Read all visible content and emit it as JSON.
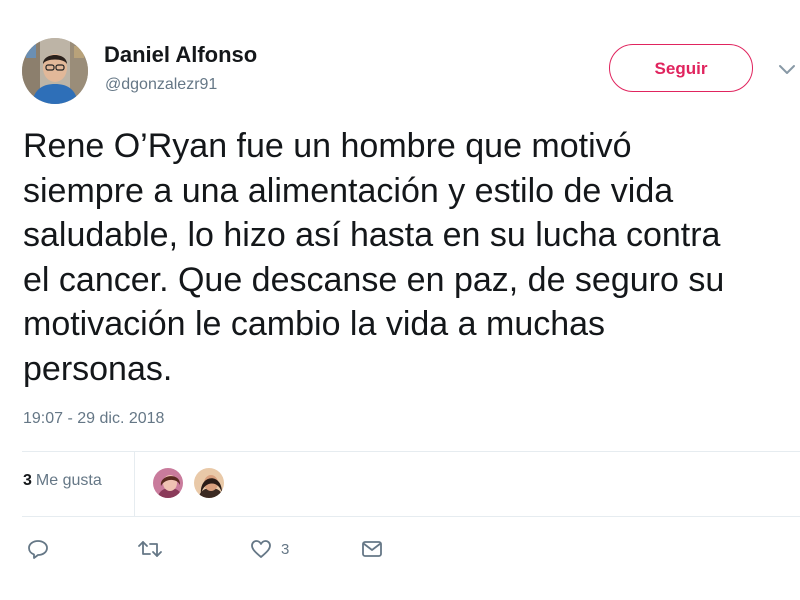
{
  "tweet": {
    "author": {
      "name": "Daniel Alfonso",
      "handle": "@dgonzalezr91"
    },
    "follow_label": "Seguir",
    "text_lines": [
      "Rene O’Ryan fue un hombre que motivó",
      "siempre a una alimentación y estilo de vida",
      "saludable, lo hizo así hasta en su lucha contra",
      "el cancer. Que descanse en paz, de seguro su",
      "motivación le cambio la vida a muchas",
      "personas."
    ],
    "timestamp": "19:07 - 29 dic. 2018",
    "likes": {
      "count": "3",
      "label": "Me gusta"
    },
    "actions": {
      "reply_icon": "reply-icon",
      "retweet_icon": "retweet-icon",
      "like_icon": "heart-icon",
      "like_count": "3",
      "message_icon": "envelope-icon"
    }
  },
  "colors": {
    "accent": "#e0245e",
    "secondary_text": "#657786",
    "primary_text": "#14171a",
    "divider": "#e6ecf0"
  }
}
